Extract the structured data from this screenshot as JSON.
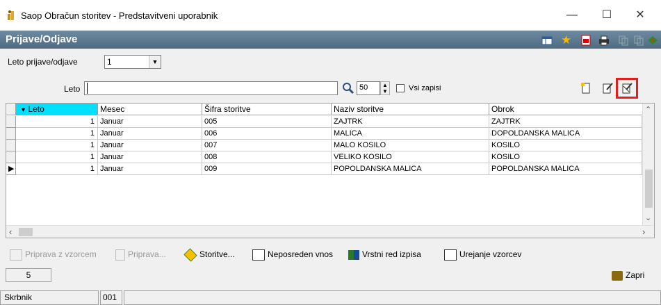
{
  "window": {
    "title": "Saop Obračun storitev - Predstavitveni uporabnik",
    "minimize": "—",
    "maximize": "☐",
    "close": "✕"
  },
  "form": {
    "title": "Prijave/Odjave"
  },
  "filter": {
    "leto_label": "Leto prijave/odjave",
    "leto_value": "1"
  },
  "search": {
    "label": "Leto",
    "value": "",
    "count": "50",
    "vsi_zapisi": "Vsi zapisi"
  },
  "grid": {
    "columns": [
      "Leto",
      "Mesec",
      "Šifra storitve",
      "Naziv storitve",
      "Obrok"
    ],
    "rows": [
      [
        "1",
        "Januar",
        "005",
        "ZAJTRK",
        "ZAJTRK"
      ],
      [
        "1",
        "Januar",
        "006",
        "MALICA",
        "DOPOLDANSKA MALICA"
      ],
      [
        "1",
        "Januar",
        "007",
        "MALO KOSILO",
        "KOSILO"
      ],
      [
        "1",
        "Januar",
        "008",
        "VELIKO KOSILO",
        "KOSILO"
      ],
      [
        "1",
        "Januar",
        "009",
        "POPOLDANSKA MALICA",
        "POPOLDANSKA MALICA"
      ]
    ]
  },
  "toolbar": {
    "priprava_vzorcem": "Priprava z vzorcem",
    "priprava": "Priprava...",
    "storitve": "Storitve...",
    "neposreden_vnos": "Neposreden vnos",
    "vrstni_red": "Vrstni red izpisa",
    "urejanje_vzorcev": "Urejanje vzorcev",
    "zapri": "Zapri"
  },
  "status": {
    "count": "5",
    "user": "Skrbnik",
    "code": "001"
  },
  "colors": {
    "accent_header": "#5a7891",
    "selected_column": "#00e0ff",
    "highlight": "#e0201c"
  }
}
